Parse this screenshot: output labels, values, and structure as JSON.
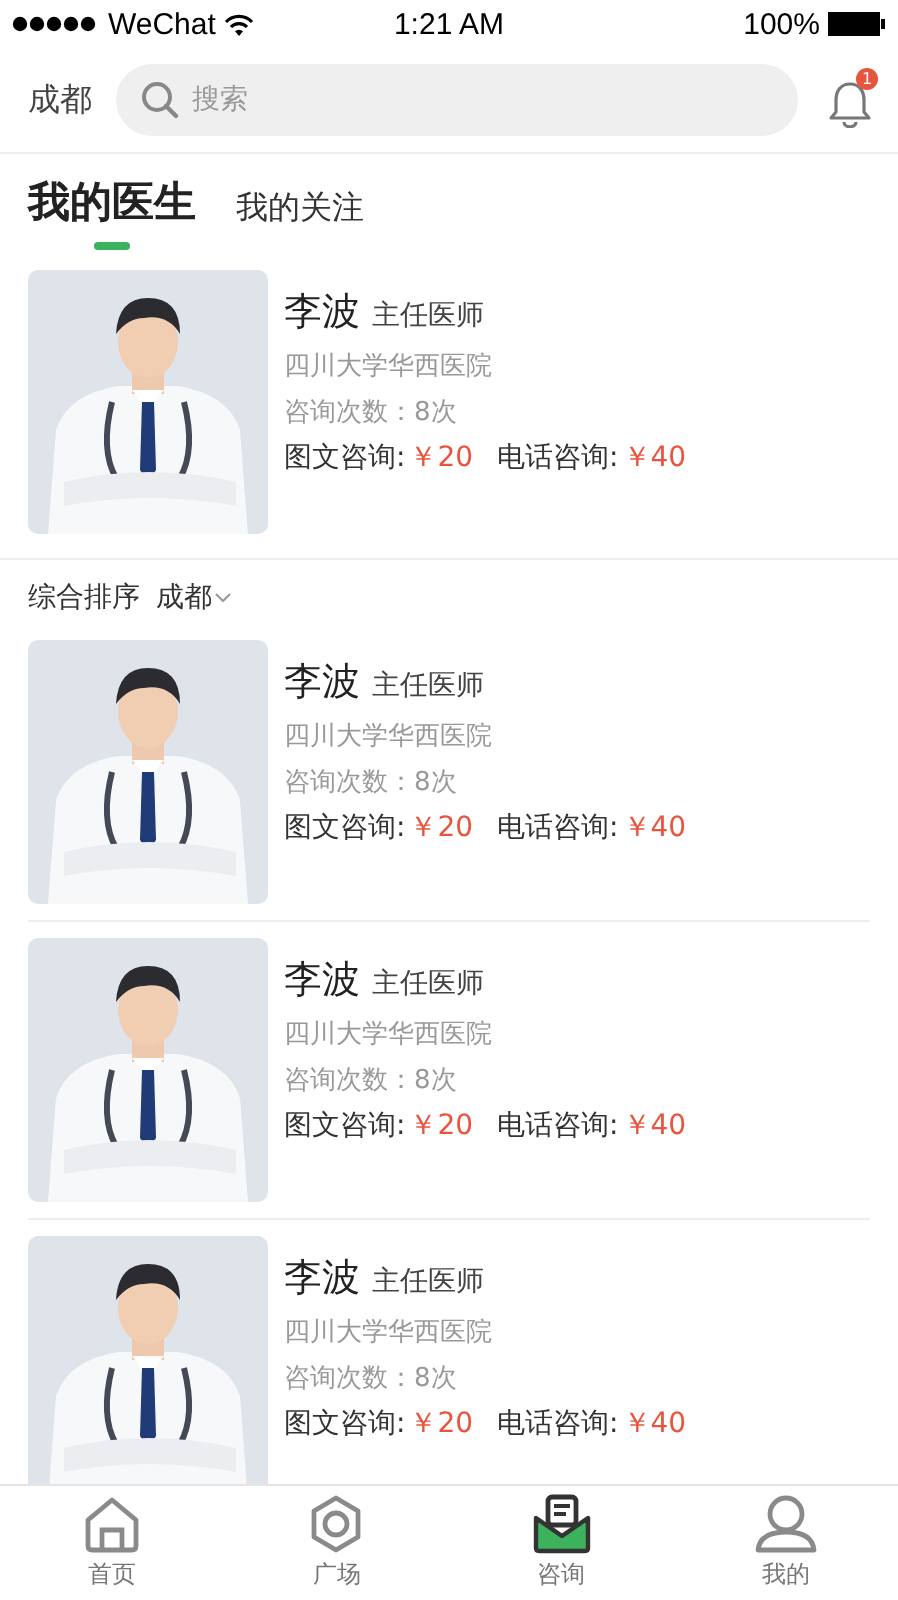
{
  "status_bar": {
    "carrier": "WeChat",
    "time": "1:21 AM",
    "battery": "100%"
  },
  "header": {
    "city": "成都",
    "search": {
      "placeholder": "搜索"
    },
    "notification_badge": "1"
  },
  "tabs": [
    {
      "label": "我的医生",
      "selected": true
    },
    {
      "label": "我的关注",
      "selected": false
    }
  ],
  "featured_doctor": {
    "name": "李波",
    "title": "主任医师",
    "hospital": "四川大学华西医院",
    "consult_count": "咨询次数：8次",
    "text_label": "图文咨询:",
    "text_price": "￥20",
    "phone_label": "电话咨询:",
    "phone_price": "￥40"
  },
  "sort_bar": {
    "sort": "综合排序",
    "city": "成都"
  },
  "doctors": [
    {
      "name": "李波",
      "title": "主任医师",
      "hospital": "四川大学华西医院",
      "consult_count": "咨询次数：8次",
      "text_label": "图文咨询:",
      "text_price": "￥20",
      "phone_label": "电话咨询:",
      "phone_price": "￥40"
    },
    {
      "name": "李波",
      "title": "主任医师",
      "hospital": "四川大学华西医院",
      "consult_count": "咨询次数：8次",
      "text_label": "图文咨询:",
      "text_price": "￥20",
      "phone_label": "电话咨询:",
      "phone_price": "￥40"
    },
    {
      "name": "李波",
      "title": "主任医师",
      "hospital": "四川大学华西医院",
      "consult_count": "咨询次数：8次",
      "text_label": "图文咨询:",
      "text_price": "￥20",
      "phone_label": "电话咨询:",
      "phone_price": "￥40"
    }
  ],
  "bottom_tabs": [
    {
      "label": "首页",
      "kind": "home",
      "selected": false
    },
    {
      "label": "广场",
      "kind": "square",
      "selected": false
    },
    {
      "label": "咨询",
      "kind": "consult",
      "selected": true
    },
    {
      "label": "我的",
      "kind": "me",
      "selected": false
    }
  ]
}
